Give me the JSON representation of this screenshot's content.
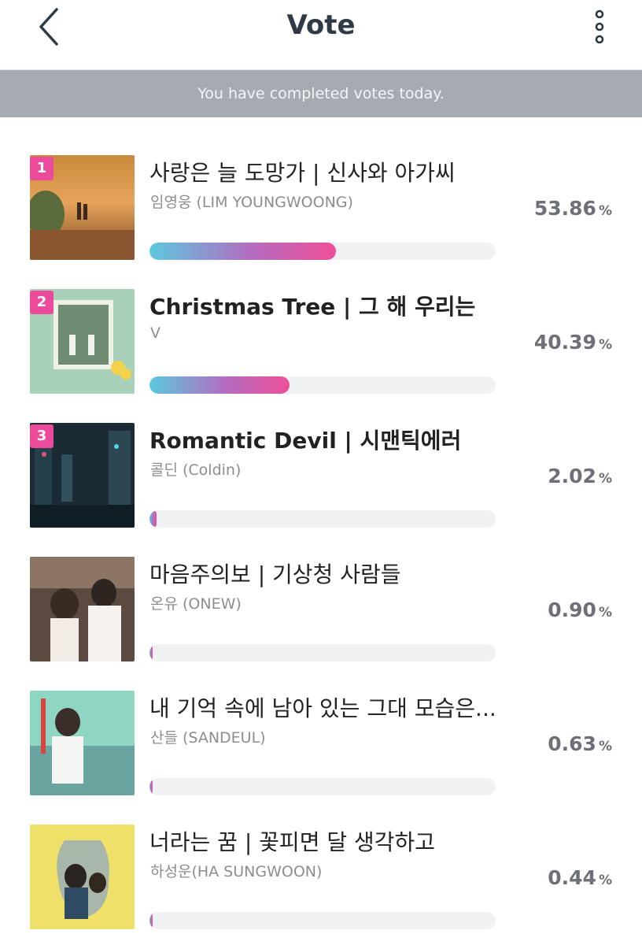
{
  "header": {
    "title": "Vote",
    "back_icon": "chevron-left-icon",
    "more_icon": "more-vertical-icon"
  },
  "banner": {
    "text": "You have completed votes today."
  },
  "colors": {
    "badge": "#ec4a9b",
    "bar_start": "#5cc8de",
    "bar_end": "#ef4f98",
    "banner_bg": "#a5aab3",
    "title": "#2f3a47"
  },
  "items": [
    {
      "rank": "1",
      "title": "사랑은 늘 도망가 | 신사와 아가씨",
      "artist": "임영웅 (LIM YOUNGWOONG)",
      "percent": "53.86",
      "unit": "%",
      "ratio": 0.5386
    },
    {
      "rank": "2",
      "title": "Christmas Tree | 그 해 우리는",
      "artist": "V",
      "percent": "40.39",
      "unit": "%",
      "ratio": 0.4039
    },
    {
      "rank": "3",
      "title": "Romantic Devil | 시맨틱에러",
      "artist": "콜딘 (Coldin)",
      "percent": "2.02",
      "unit": "%",
      "ratio": 0.0202
    },
    {
      "rank": "",
      "title": "마음주의보 | 기상청 사람들",
      "artist": "온유 (ONEW)",
      "percent": "0.90",
      "unit": "%",
      "ratio": 0.009
    },
    {
      "rank": "",
      "title": "내 기억 속에 남아 있는 그대 모습은...",
      "artist": "산들 (SANDEUL)",
      "percent": "0.63",
      "unit": "%",
      "ratio": 0.0063
    },
    {
      "rank": "",
      "title": "너라는 꿈 | 꽃피면 달 생각하고",
      "artist": "하성운(HA SUNGWOON)",
      "percent": "0.44",
      "unit": "%",
      "ratio": 0.0044
    }
  ]
}
